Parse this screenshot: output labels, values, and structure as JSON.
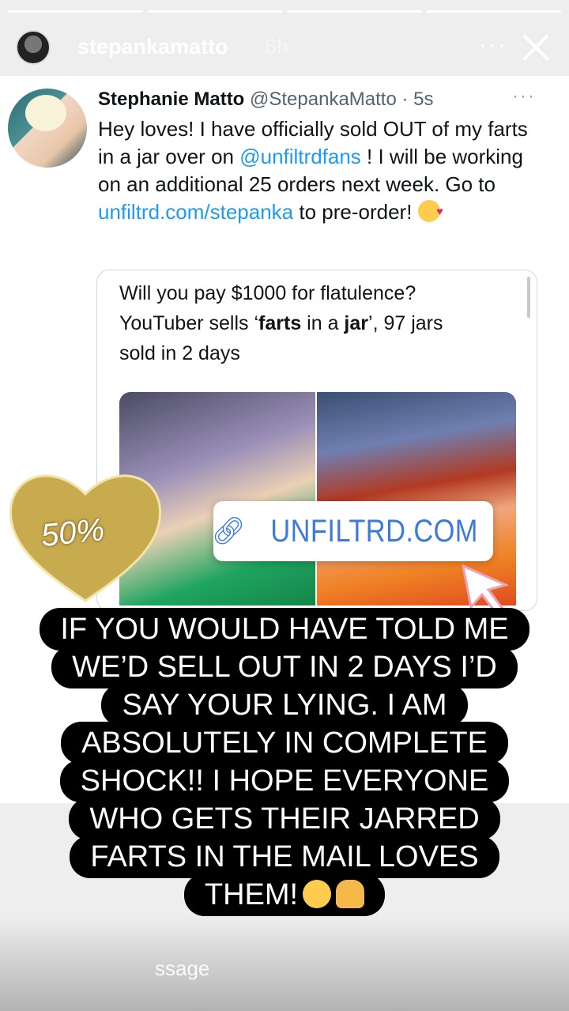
{
  "story": {
    "username": "stepankamatto",
    "time": "6h",
    "more": "···",
    "progress_segments": 4,
    "avatar_icon": "profile-avatar",
    "close_icon": "close-icon"
  },
  "tweet": {
    "display_name": "Stephanie Matto",
    "handle_time": "@StepankaMatto · 5s",
    "more": "···",
    "text_part1": "Hey loves! I have officially sold OUT of my farts in a jar over on ",
    "mention": "@unfiltrdfans",
    "text_part2": " ! I will be working on an additional 25 orders next week. Go to ",
    "link": "unfiltrd.com/stepanka",
    "text_part3": " to pre-order! ",
    "quote": {
      "line1": "Will you pay $1000 for flatulence?",
      "line2a": "YouTuber sells ‘",
      "bold1": "farts",
      "line2b": " in a ",
      "bold2": "jar",
      "line2c": "’, 97 jars",
      "line3": "sold in 2 days"
    }
  },
  "stickers": {
    "heart_label": "50%",
    "heart_color": "#c9ab4f",
    "link_text": "UNFILTRD.COM",
    "link_color": "#3b7bdc"
  },
  "caption": {
    "lines": [
      "IF YOU WOULD HAVE TOLD ME",
      "WE’D SELL OUT IN 2 DAYS I’D",
      "SAY YOUR LYING. I AM",
      "ABSOLUTELY IN COMPLETE",
      "SHOCK!! I HOPE EVERYONE",
      "WHO GETS THEIR JARRED",
      "FARTS IN THE MAIL LOVES",
      "THEM!"
    ]
  },
  "reply": {
    "ghost_text": "ssage"
  }
}
